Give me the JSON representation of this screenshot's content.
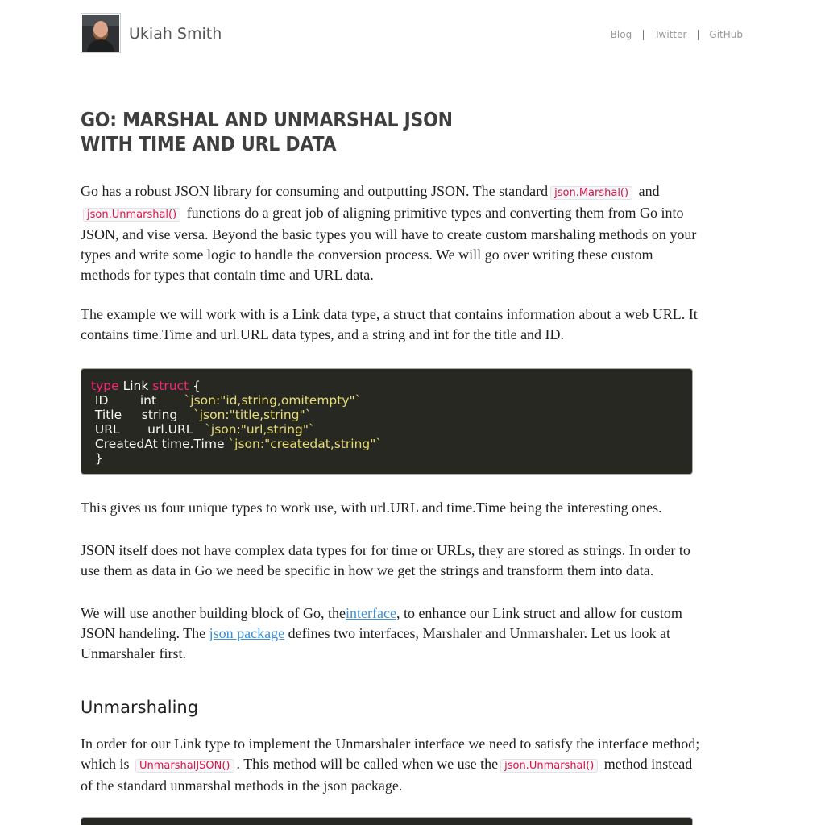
{
  "header": {
    "site_name": "Ukiah Smith",
    "avatar": "author-photo",
    "nav": [
      "Blog",
      "Twitter",
      "GitHub"
    ]
  },
  "post": {
    "title_line1": "GO: MARSHAL AND UNMARSHAL JSON",
    "title_line2": "WITH TIME AND URL DATA",
    "p1": {
      "a": "Go has a robust JSON library for consuming and outputting JSON. The standard",
      "code1": "json.Marshal()",
      "b": "and",
      "code2": "json.Unmarshal()",
      "c": "functions do a great job of aligning primitive types and converting them from Go into JSON, and vise versa. Beyond the basic types you will have to create custom marshaling methods on your types and write some logic to handle the conversion process. We will go over writing these custom methods for types that contain time and URL data."
    },
    "p2": "The example we will work with is a Link data type, a struct that contains information about a web URL. It contains time.Time and url.URL data types, and a string and int for the title and ID.",
    "code": {
      "l1_kw1": "type",
      "l1_name": " Link ",
      "l1_kw2": "struct",
      "l1_brace": " {",
      "l2_field": " ID        int       ",
      "l2_tag": "`json:\"id,string,omitempty\"`",
      "l3_field": " Title     string    ",
      "l3_tag": "`json:\"title,string\"`",
      "l4_field": " URL       url.URL   ",
      "l4_tag": "`json:\"url,string\"`",
      "l5_field": " CreatedAt time.Time ",
      "l5_tag": "`json:\"createdat,string\"`",
      "l6": " }"
    },
    "p3": "This gives us four unique types to work use, with url.URL and time.Time being the interesting ones.",
    "p4": "JSON itself does not have complex data types for for time or URLs, they are stored as strings. In order to use them as data in Go we need be specific in how we get the strings and transform them into data.",
    "p5": {
      "a": "We will use another building block of Go, the",
      "link1": "interface",
      "b": ", to enhance our Link struct and allow for custom JSON handeling. The",
      "link2": "json package",
      "c": "defines two interfaces, Marshaler and Unmarshaler. Let us look at Unmarshaler first."
    },
    "section_heading": "Unmarshaling",
    "p6": {
      "a": "In order for our Link type to implement the Unmarshaler interface we need to satisfy the interface method; which is",
      "code1": "UnmarshalJSON()",
      "b": ". This method will be called when we use the",
      "code2": "json.Unmarshal()",
      "c": "method instead of the standard unmarshal methods in the json package."
    }
  }
}
